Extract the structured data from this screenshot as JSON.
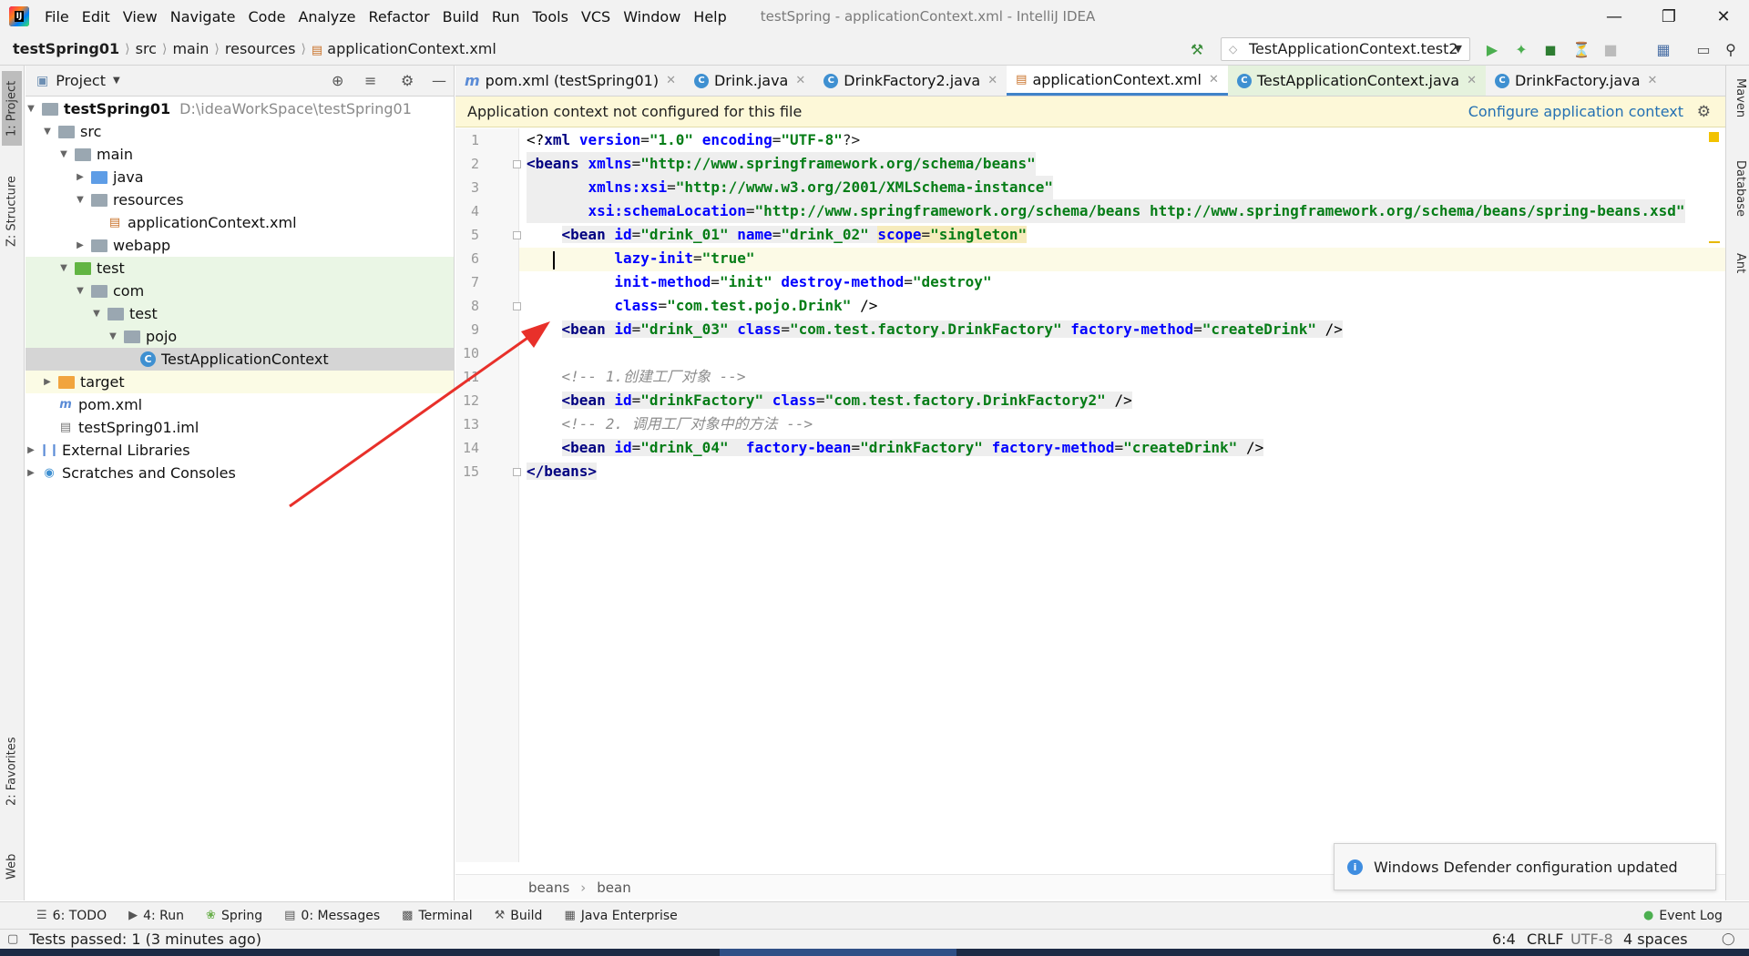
{
  "window": {
    "title": "testSpring - applicationContext.xml - IntelliJ IDEA",
    "menu": [
      "File",
      "Edit",
      "View",
      "Navigate",
      "Code",
      "Analyze",
      "Refactor",
      "Build",
      "Run",
      "Tools",
      "VCS",
      "Window",
      "Help"
    ]
  },
  "navbar": {
    "breadcrumbs": [
      "testSpring01",
      "src",
      "main",
      "resources",
      "applicationContext.xml"
    ],
    "run_config": "TestApplicationContext.test2"
  },
  "left_stripe": {
    "project": "1: Project",
    "structure": "Z: Structure",
    "favorites": "2: Favorites",
    "web": "Web"
  },
  "right_stripe": {
    "maven": "Maven",
    "database": "Database",
    "ant": "Ant"
  },
  "project_panel": {
    "title": "Project",
    "tree": [
      {
        "label": "testSpring01",
        "path": "D:\\ideaWorkSpace\\testSpring01"
      },
      {
        "label": "src"
      },
      {
        "label": "main"
      },
      {
        "label": "java"
      },
      {
        "label": "resources"
      },
      {
        "label": "applicationContext.xml"
      },
      {
        "label": "webapp"
      },
      {
        "label": "test"
      },
      {
        "label": "com"
      },
      {
        "label": "test"
      },
      {
        "label": "pojo"
      },
      {
        "label": "TestApplicationContext"
      },
      {
        "label": "target"
      },
      {
        "label": "pom.xml"
      },
      {
        "label": "testSpring01.iml"
      },
      {
        "label": "External Libraries"
      },
      {
        "label": "Scratches and Consoles"
      }
    ]
  },
  "tabs": [
    {
      "label": "pom.xml (testSpring01)"
    },
    {
      "label": "Drink.java"
    },
    {
      "label": "DrinkFactory2.java"
    },
    {
      "label": "applicationContext.xml"
    },
    {
      "label": "TestApplicationContext.java"
    },
    {
      "label": "DrinkFactory.java"
    }
  ],
  "banner": {
    "message": "Application context not configured for this file",
    "link": "Configure application context"
  },
  "editor": {
    "line_numbers": [
      "1",
      "2",
      "3",
      "4",
      "5",
      "6",
      "7",
      "8",
      "9",
      "10",
      "11",
      "12",
      "13",
      "14",
      "15"
    ],
    "code": {
      "l1_a": "<?",
      "l1_b": "xml",
      "l1_c": "version",
      "l1_d": "\"1.0\"",
      "l1_e": "encoding",
      "l1_f": "\"UTF-8\"",
      "l2_tag": "<beans",
      "l2_attr": "xmlns",
      "l2_val": "\"http://www.springframework.org/schema/beans\"",
      "l3_attr": "xmlns:xsi",
      "l3_val": "\"http://www.w3.org/2001/XMLSchema-instance\"",
      "l4_attr": "xsi:schemaLocation",
      "l4_val": "\"http://www.springframework.org/schema/beans http://www.springframework.org/schema/beans/spring-beans.xsd\"",
      "l5_tag": "<bean",
      "l5_a1": "id",
      "l5_v1": "\"drink_01\"",
      "l5_a2": "name",
      "l5_v2": "\"drink_02\"",
      "l5_a3": "scope",
      "l5_v3": "\"singleton\"",
      "l6_attr": "lazy-init",
      "l6_val": "\"true\"",
      "l7_a1": "init-method",
      "l7_v1": "\"init\"",
      "l7_a2": "destroy-method",
      "l7_v2": "\"destroy\"",
      "l8_attr": "class",
      "l8_val": "\"com.test.pojo.Drink\"",
      "l8_end": " />",
      "l9_tag": "<bean",
      "l9_a1": "id",
      "l9_v1": "\"drink_03\"",
      "l9_a2": "class",
      "l9_v2": "\"com.test.factory.DrinkFactory\"",
      "l9_a3": "factory-method",
      "l9_v3": "\"createDrink\"",
      "l9_end": " />",
      "l11": "<!-- 1.创建工厂对象 -->",
      "l12_tag": "<bean",
      "l12_a1": "id",
      "l12_v1": "\"drinkFactory\"",
      "l12_a2": "class",
      "l12_v2": "\"com.test.factory.DrinkFactory2\"",
      "l12_end": " />",
      "l13": "<!-- 2. 调用工厂对象中的方法 -->",
      "l14_tag": "<bean",
      "l14_a1": "id",
      "l14_v1": "\"drink_04\"",
      "l14_a2": "factory-bean",
      "l14_v2": "\"drinkFactory\"",
      "l14_a3": "factory-method",
      "l14_v3": "\"createDrink\"",
      "l14_end": " />",
      "l15": "</beans>"
    },
    "breadcrumbs": [
      "beans",
      "bean"
    ]
  },
  "notification": {
    "text": "Windows Defender configuration updated"
  },
  "tool_windows": [
    "6: TODO",
    "4: Run",
    "Spring",
    "0: Messages",
    "Terminal",
    "Build",
    "Java Enterprise"
  ],
  "event_log": "Event Log",
  "status": {
    "message": "Tests passed: 1 (3 minutes ago)",
    "position": "6:4",
    "line_sep": "CRLF",
    "encoding": "UTF-8",
    "indent": "4 spaces"
  },
  "colors": {
    "accent": "#4083c9",
    "banner_bg": "#fdf8d8",
    "tag": "#000080",
    "attr": "#0000ff",
    "value": "#067d17",
    "arrow": "#e8302a"
  }
}
